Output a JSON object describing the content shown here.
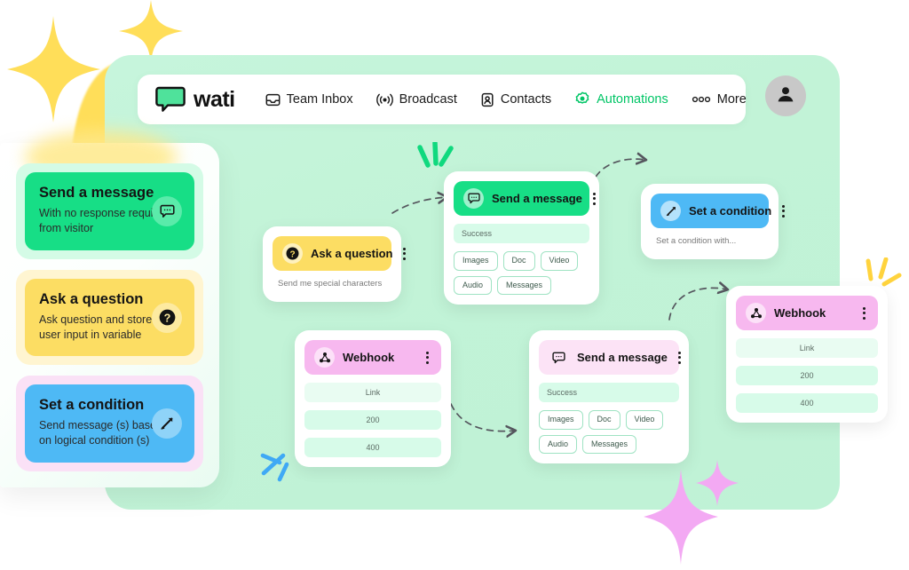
{
  "brand": {
    "name": "wati",
    "logo_icon": "chat-bubble-logo"
  },
  "navbar": {
    "items": [
      {
        "label": "Team Inbox",
        "icon": "inbox-icon",
        "active": false
      },
      {
        "label": "Broadcast",
        "icon": "broadcast-icon",
        "active": false
      },
      {
        "label": "Contacts",
        "icon": "contacts-icon",
        "active": false
      },
      {
        "label": "Automations",
        "icon": "gear-icon",
        "active": true
      },
      {
        "label": "More",
        "icon": "more-dots-icon",
        "active": false
      }
    ],
    "avatar_icon": "user-avatar-icon"
  },
  "sidebar": {
    "cards": [
      {
        "title": "Send a message",
        "desc": "With no response required from visitor",
        "icon": "chat-bubble-icon",
        "theme": "green"
      },
      {
        "title": "Ask a question",
        "desc": "Ask question and store user input in variable",
        "icon": "question-mark-icon",
        "theme": "yellow"
      },
      {
        "title": "Set a condition",
        "desc": "Send message (s) based on logical condition (s)",
        "icon": "rocket-icon",
        "theme": "blue"
      }
    ]
  },
  "canvas": {
    "nodes": [
      {
        "id": "ask-question",
        "title": "Ask a question",
        "icon": "question-mark-icon",
        "theme": "yellow",
        "subtext": "Send me special characters",
        "menu_icon": "kebab-menu-icon"
      },
      {
        "id": "send-message-1",
        "title": "Send a message",
        "icon": "chat-bubble-icon",
        "theme": "green",
        "menu_icon": "kebab-menu-icon",
        "field_label": "Success",
        "chips": [
          "Images",
          "Doc",
          "Video",
          "Audio",
          "Messages"
        ]
      },
      {
        "id": "set-condition",
        "title": "Set a condition",
        "icon": "rocket-icon",
        "theme": "blue",
        "subtext": "Set a condition with...",
        "menu_icon": "kebab-menu-icon"
      },
      {
        "id": "webhook-1",
        "title": "Webhook",
        "icon": "webhook-icon",
        "theme": "pink",
        "menu_icon": "kebab-menu-icon",
        "rows": [
          "Link",
          "200",
          "400"
        ]
      },
      {
        "id": "send-message-2",
        "title": "Send a message",
        "icon": "chat-bubble-icon",
        "theme": "pinkpale",
        "menu_icon": "kebab-menu-icon",
        "field_label": "Success",
        "chips": [
          "Images",
          "Doc",
          "Video",
          "Audio",
          "Messages"
        ]
      },
      {
        "id": "webhook-2",
        "title": "Webhook",
        "icon": "webhook-icon",
        "theme": "pink",
        "menu_icon": "kebab-menu-icon",
        "rows": [
          "Link",
          "200",
          "400"
        ]
      }
    ]
  },
  "colors": {
    "brand_green": "#17DE86",
    "active_nav": "#00C566",
    "canvas_mint": "#C2F3D7",
    "card_yellow": "#FCDD63",
    "card_blue": "#4EB9F5",
    "node_pink": "#F7B8EF",
    "sparkle_yellow": "#FFDE59",
    "sparkle_pink": "#F3A9F3"
  }
}
